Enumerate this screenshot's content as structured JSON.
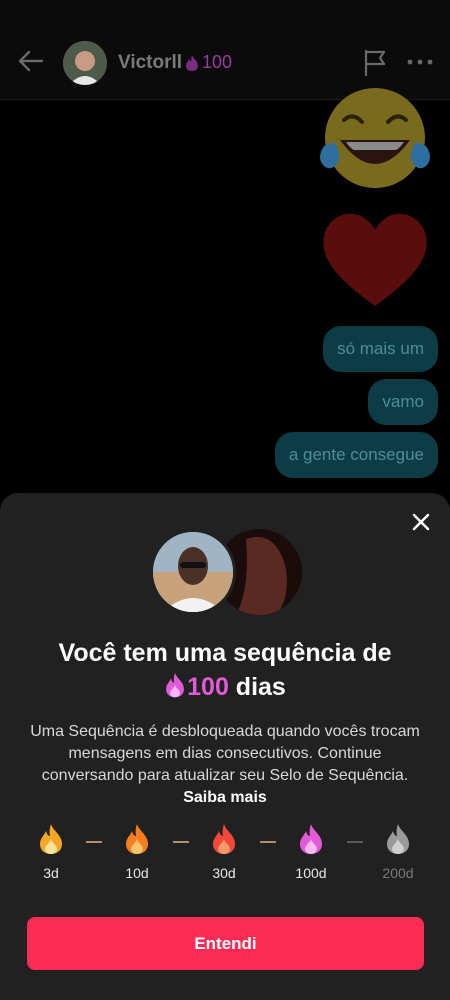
{
  "header": {
    "name": "Victorll",
    "streak_count": "100"
  },
  "chat": {
    "messages": [
      {
        "text": "só mais um"
      },
      {
        "text": "vamo"
      },
      {
        "text": "a gente consegue"
      }
    ]
  },
  "sheet": {
    "title_line1": "Você tem uma sequência de",
    "title_count": "100",
    "title_suffix": " dias",
    "description": "Uma Sequência é desbloqueada quando vocês trocam mensagens em dias consecutivos. Continue conversando para atualizar seu Selo de Sequência.",
    "learn_more": "Saiba mais",
    "milestones": [
      {
        "label": "3d",
        "color": "#f5a623",
        "achieved": true
      },
      {
        "label": "10d",
        "color": "#f57c1f",
        "achieved": true
      },
      {
        "label": "30d",
        "color": "#f2473a",
        "achieved": true
      },
      {
        "label": "100d",
        "color": "#e35ad8",
        "achieved": true
      },
      {
        "label": "200d",
        "color": "#9a9a9a",
        "achieved": false
      }
    ],
    "button_label": "Entendi"
  },
  "colors": {
    "accent": "#fe2c55",
    "streak_pink": "#e35ad8",
    "bubble": "#0c3d47"
  }
}
